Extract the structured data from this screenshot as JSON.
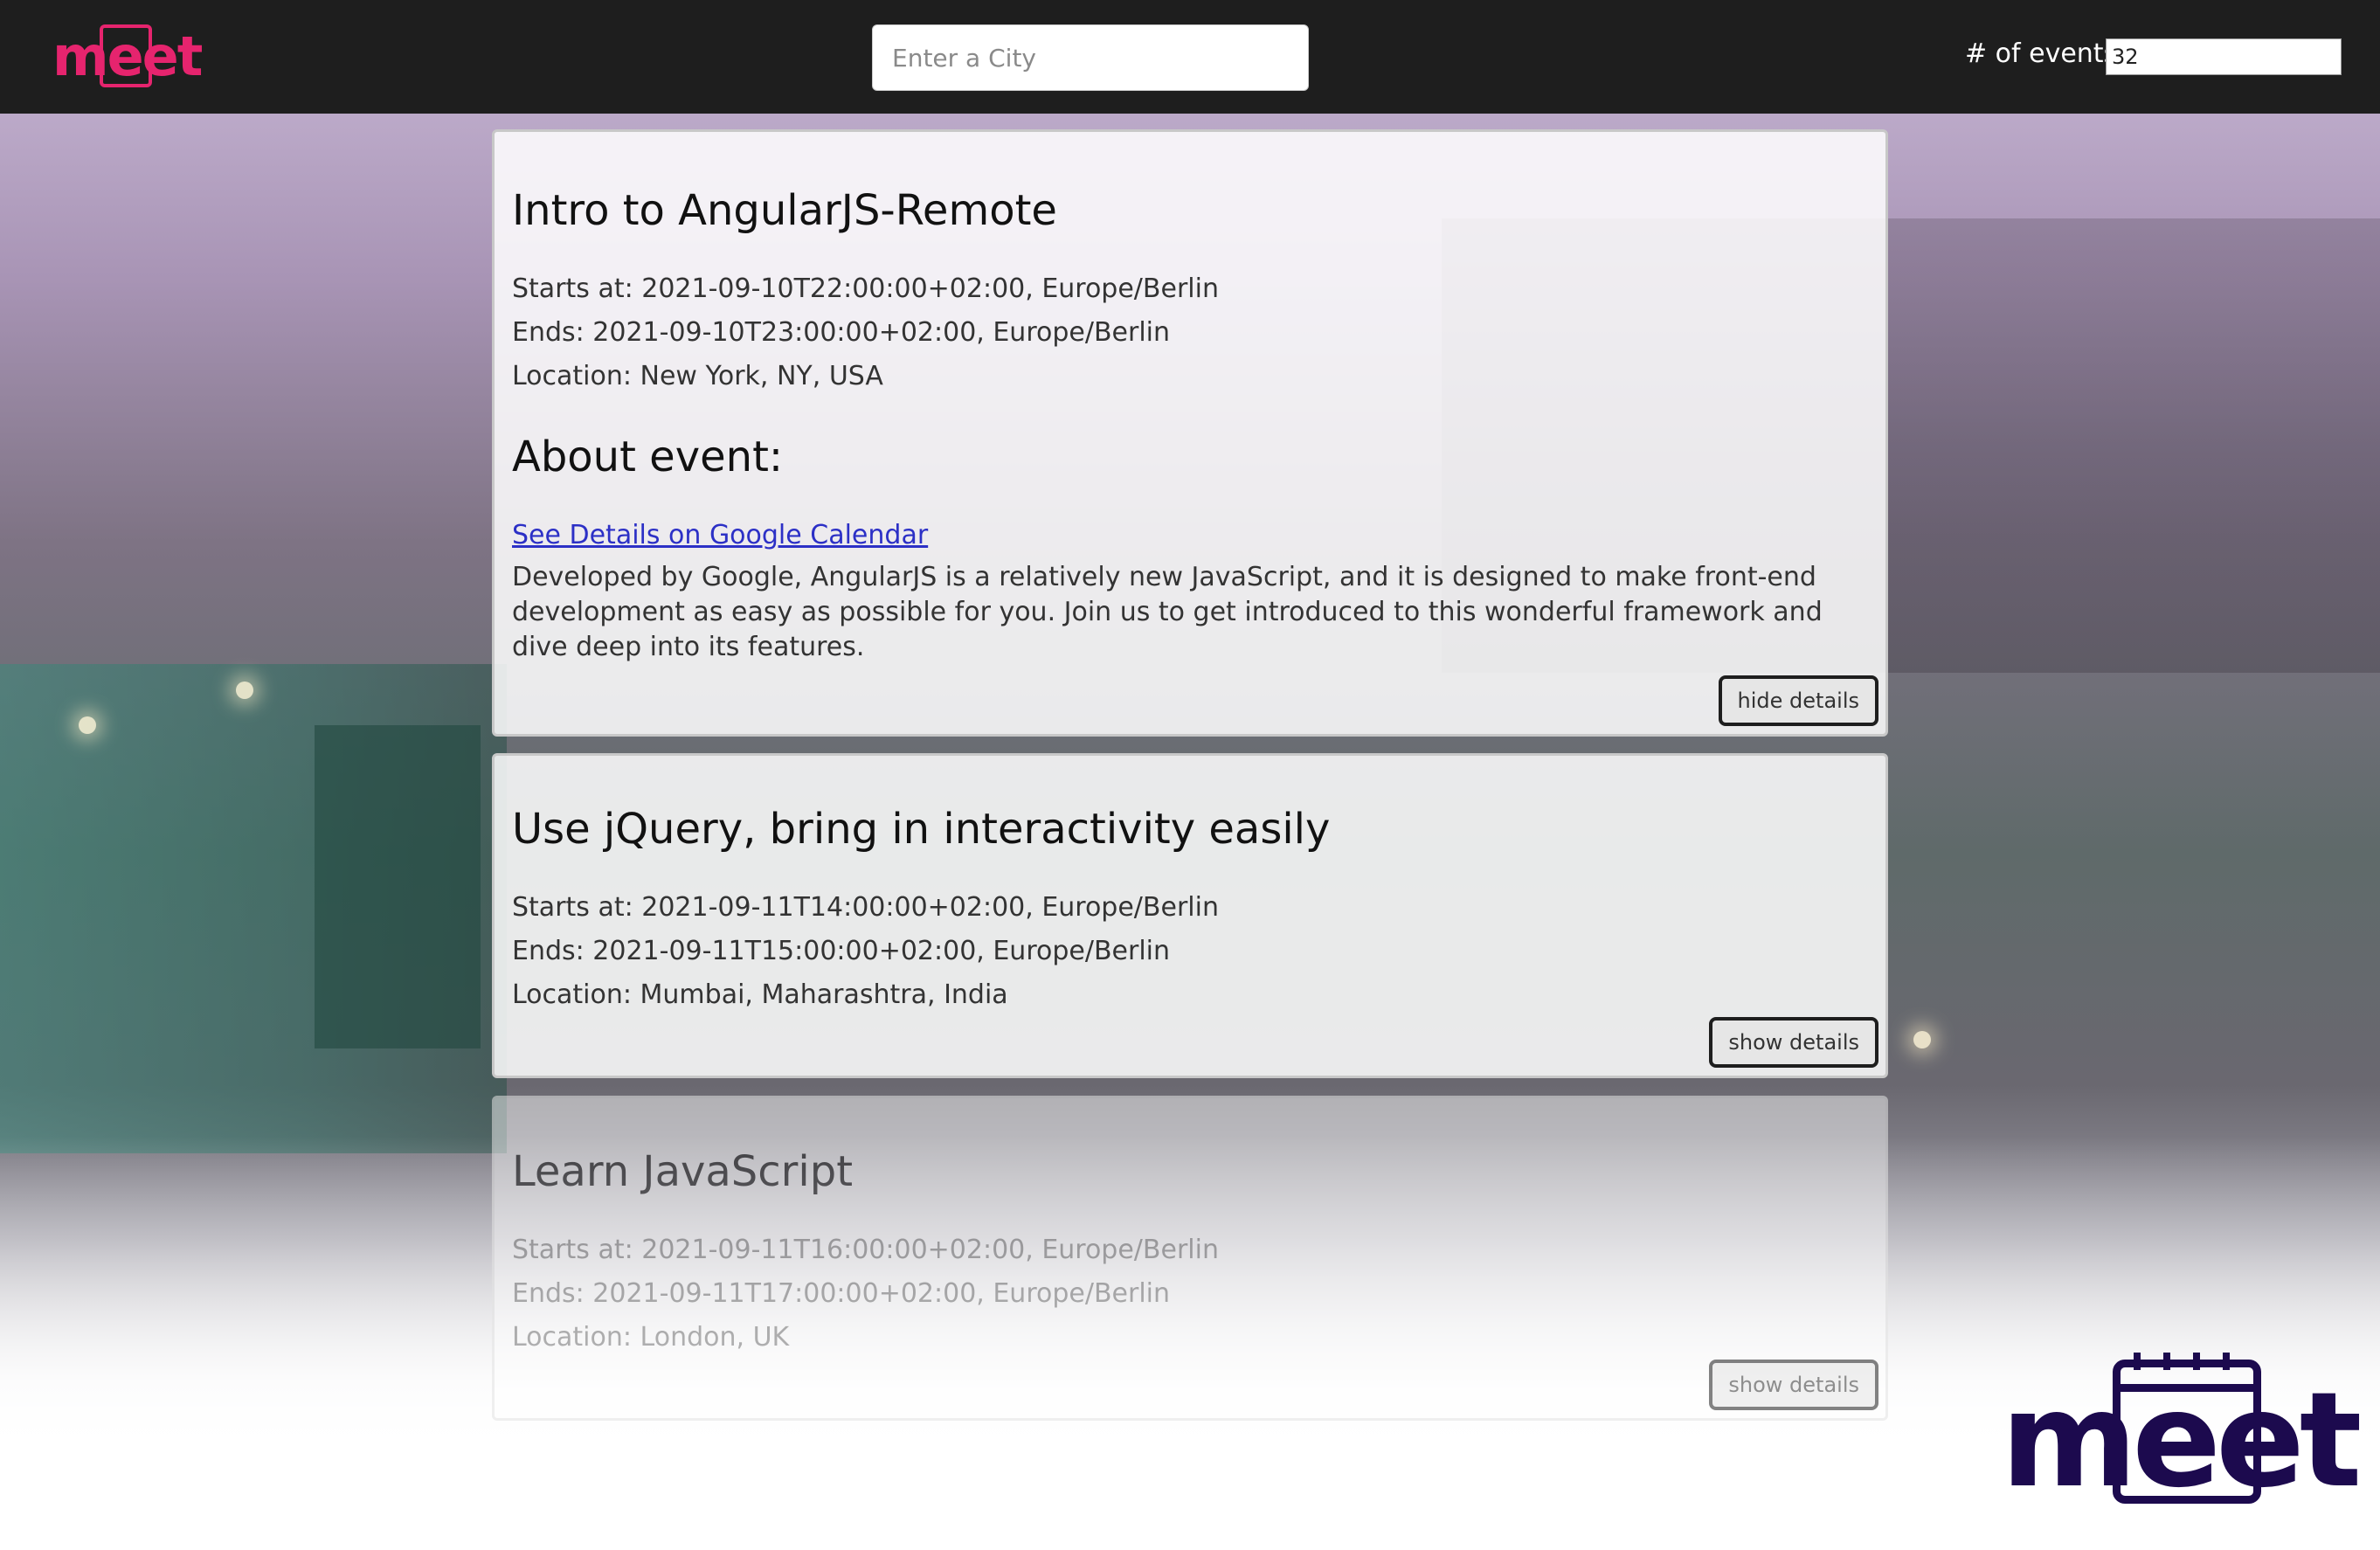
{
  "app": {
    "logo_text": "meet",
    "brand_color": "#e6246e",
    "brand_dark_color": "#1c0a4e"
  },
  "navbar": {
    "city_placeholder": "Enter a City",
    "events_label": "# of events",
    "events_value": "32"
  },
  "events": [
    {
      "title": "Intro to AngularJS-Remote",
      "starts": "Starts at: 2021-09-10T22:00:00+02:00, Europe/Berlin",
      "ends": "Ends: 2021-09-10T23:00:00+02:00, Europe/Berlin",
      "location": "Location: New York, NY, USA",
      "about_heading": "About event:",
      "link_text": "See Details on Google Calendar",
      "description": "Developed by Google, AngularJS is a relatively new JavaScript, and it is designed to make front-end development as easy as possible for you. Join us to get introduced to this wonderful framework and dive deep into its features.",
      "button_label": "hide details"
    },
    {
      "title": "Use jQuery, bring in interactivity easily",
      "starts": "Starts at: 2021-09-11T14:00:00+02:00, Europe/Berlin",
      "ends": "Ends: 2021-09-11T15:00:00+02:00, Europe/Berlin",
      "location": "Location: Mumbai, Maharashtra, India",
      "button_label": "show details"
    },
    {
      "title": "Learn JavaScript",
      "starts": "Starts at: 2021-09-11T16:00:00+02:00, Europe/Berlin",
      "ends": "Ends: 2021-09-11T17:00:00+02:00, Europe/Berlin",
      "location": "Location: London, UK",
      "button_label": "show details"
    }
  ]
}
